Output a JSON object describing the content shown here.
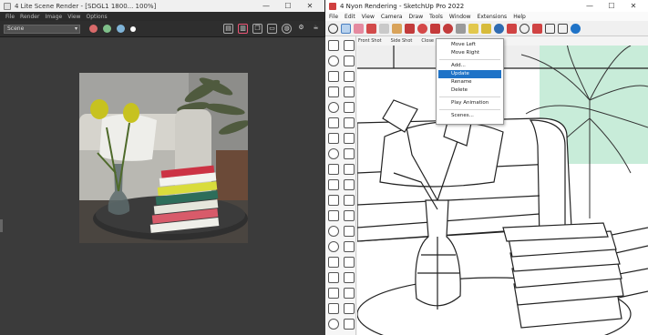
{
  "render_window": {
    "title": "4 Lite Scene Render - [SDGL1 1800... 100%]",
    "menu": [
      "File",
      "Render",
      "Image",
      "View",
      "Options"
    ],
    "dropdown_value": "Scene",
    "status_dots": [
      "#d96a6a",
      "#7fc08a",
      "#7fb4d8",
      "#ffffff"
    ],
    "window_controls": [
      "—",
      "☐",
      "✕"
    ]
  },
  "sketchup_window": {
    "title": "4 Nyon Rendering - SketchUp Pro 2022",
    "menu": [
      "File",
      "Edit",
      "View",
      "Camera",
      "Draw",
      "Tools",
      "Window",
      "Extensions",
      "Help"
    ],
    "scene_tabs": [
      "Front Shot",
      "Side Shot",
      "Close Up"
    ],
    "window_controls": [
      "—",
      "☐",
      "✕"
    ]
  },
  "context_menu": {
    "items": [
      {
        "label": "Move Left",
        "active": false
      },
      {
        "label": "Move Right",
        "active": false
      },
      {
        "sep": true
      },
      {
        "label": "Add...",
        "active": false
      },
      {
        "label": "Update",
        "active": true
      },
      {
        "label": "Rename",
        "active": false
      },
      {
        "label": "Delete",
        "active": false
      },
      {
        "sep": true
      },
      {
        "label": "Play Animation",
        "active": false
      },
      {
        "sep": true
      },
      {
        "label": "Scenes...",
        "active": false
      }
    ]
  },
  "icons": {
    "render_tools": [
      "save-icon",
      "export-icon",
      "copy-icon",
      "window-icon",
      "globe-icon",
      "settings-icon",
      "teapot-icon"
    ],
    "su_tools": [
      "search-icon",
      "select-icon",
      "eraser-icon",
      "pencil-icon",
      "paint-icon",
      "push-pull-icon",
      "move-icon",
      "rotate-icon",
      "scale-icon",
      "offset-icon",
      "tape-icon",
      "text-icon",
      "axes-icon",
      "orbit-icon",
      "pan-icon",
      "zoom-icon",
      "zoom-extents-icon",
      "previous-icon",
      "next-icon",
      "geo-icon"
    ]
  }
}
